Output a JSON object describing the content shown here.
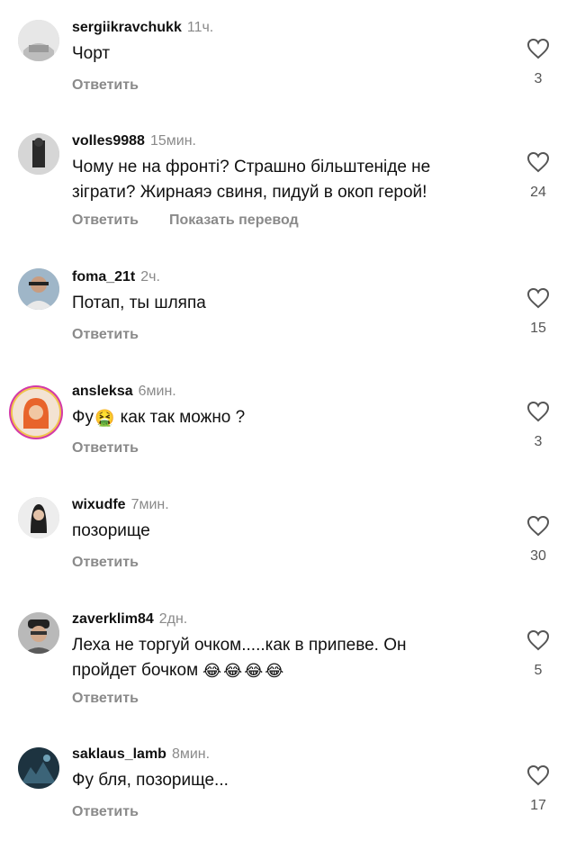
{
  "colors": {
    "username": "#111111",
    "meta": "#8a8a8a",
    "like_count": "#555555",
    "background": "#ffffff"
  },
  "reply_label": "Ответить",
  "translate_label": "Показать перевод",
  "comments": [
    {
      "username": "sergiikravchukk",
      "time": "11ч.",
      "text": "Чорт",
      "likes": "3"
    },
    {
      "username": "volles9988",
      "time": "15мин.",
      "text_line1": "Чому не на фронті? Страшно більштеніде не",
      "text_line2": "зіграти? Жирнаяэ свиня, пидуй в окоп герой!",
      "likes": "24"
    },
    {
      "username": "foma_21t",
      "time": "2ч.",
      "text": "Потап, ты шляпа",
      "likes": "15"
    },
    {
      "username": "ansleksa",
      "time": "6мин.",
      "text_before": "Фу",
      "emoji": "🤮",
      "text_after": "как так можно ?",
      "likes": "3"
    },
    {
      "username": "wixudfe",
      "time": "7мин.",
      "text": "позорище",
      "likes": "30"
    },
    {
      "username": "zaverklim84",
      "time": "2дн.",
      "text_line1": "Леха не торгуй очком.....как в припеве.  Он",
      "text_line2": "пройдет бочком",
      "emojis": [
        "😂",
        "😂",
        "😂",
        "😂"
      ],
      "likes": "5"
    },
    {
      "username": "saklaus_lamb",
      "time": "8мин.",
      "text": "Фу бля, позорище...",
      "likes": "17"
    }
  ]
}
